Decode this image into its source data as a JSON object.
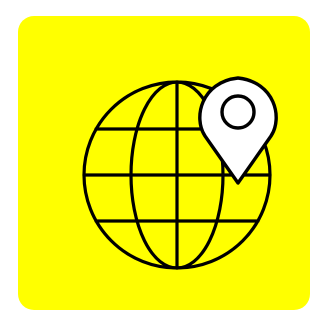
{
  "icon": {
    "name": "globe-location-pin-icon",
    "background_color": "#ffff00",
    "stroke_color": "#000000",
    "pin_fill_color": "#ffffff"
  }
}
